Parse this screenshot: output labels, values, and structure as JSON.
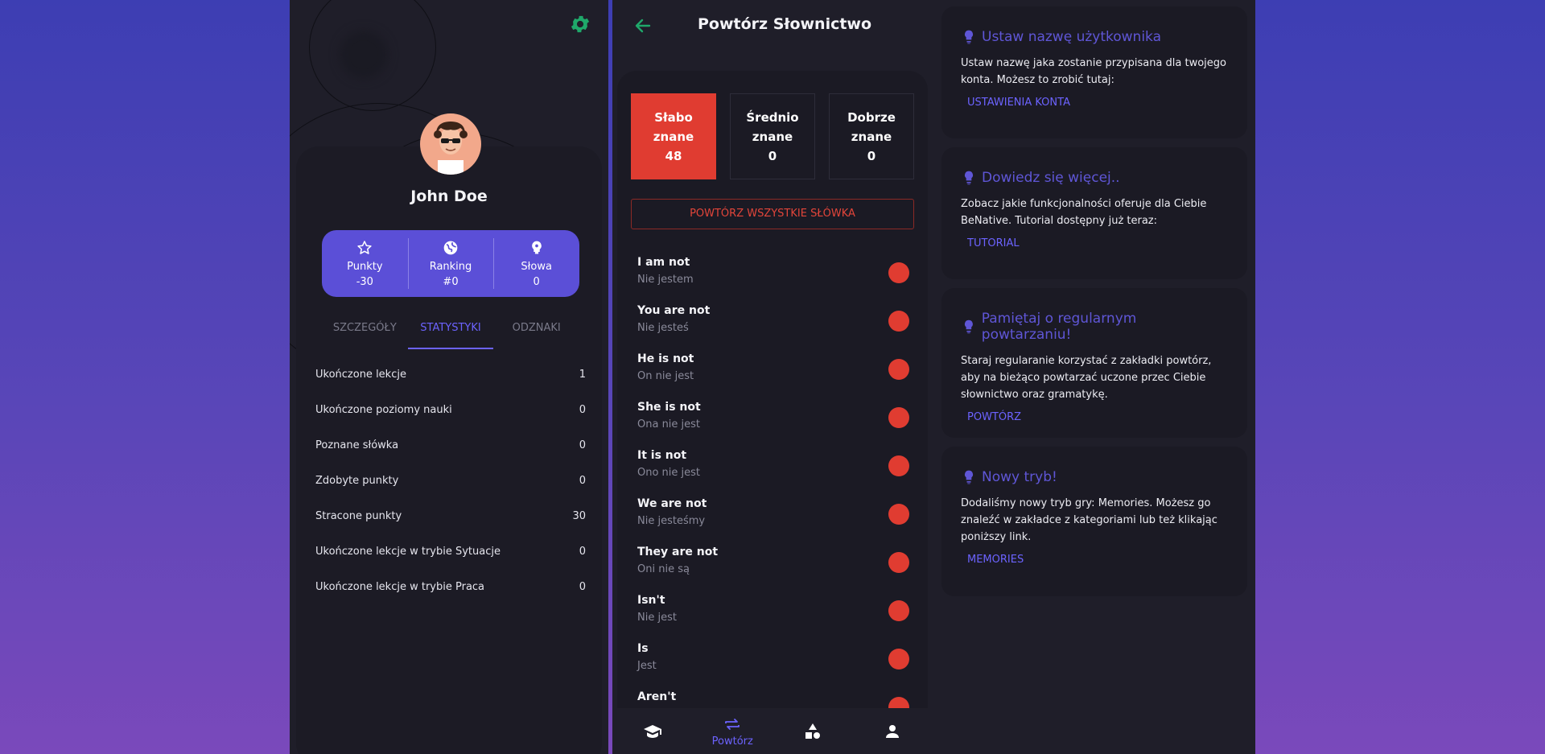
{
  "profile": {
    "name": "John Doe",
    "stats": [
      {
        "label": "Punkty",
        "value": "-30",
        "icon": "star-icon"
      },
      {
        "label": "Ranking",
        "value": "#0",
        "icon": "globe-icon"
      },
      {
        "label": "Słowa",
        "value": "0",
        "icon": "brain-icon"
      }
    ],
    "tabs": [
      "SZCZEGÓŁY",
      "STATYSTYKI",
      "ODZNAKI"
    ],
    "active_tab": "STATYSTYKI",
    "statistics": [
      {
        "label": "Ukończone lekcje",
        "value": "1"
      },
      {
        "label": "Ukończone poziomy nauki",
        "value": "0"
      },
      {
        "label": "Poznane słówka",
        "value": "0"
      },
      {
        "label": "Zdobyte punkty",
        "value": "0"
      },
      {
        "label": "Stracone punkty",
        "value": "30"
      },
      {
        "label": "Ukończone lekcje w trybie Sytuacje",
        "value": "0"
      },
      {
        "label": "Ukończone lekcje w trybie Praca",
        "value": "0"
      }
    ]
  },
  "review": {
    "title": "Powtórz Słownictwo",
    "levels": [
      {
        "line1": "Słabo",
        "line2": "znane",
        "count": "48",
        "active": true
      },
      {
        "line1": "Średnio",
        "line2": "znane",
        "count": "0",
        "active": false
      },
      {
        "line1": "Dobrze",
        "line2": "znane",
        "count": "0",
        "active": false
      }
    ],
    "repeat_all_label": "POWTÓRZ WSZYSTKIE SŁÓWKA",
    "words": [
      {
        "en": "I am not",
        "pl": "Nie jestem"
      },
      {
        "en": "You are not",
        "pl": "Nie jesteś"
      },
      {
        "en": "He is not",
        "pl": "On nie jest"
      },
      {
        "en": "She is not",
        "pl": "Ona nie jest"
      },
      {
        "en": "It is not",
        "pl": "Ono nie jest"
      },
      {
        "en": "We are not",
        "pl": "Nie jesteśmy"
      },
      {
        "en": "They are not",
        "pl": "Oni nie są"
      },
      {
        "en": "Isn't",
        "pl": "Nie jest"
      },
      {
        "en": "Is",
        "pl": "Jest"
      },
      {
        "en": "Aren't",
        "pl": ""
      }
    ],
    "nav": [
      {
        "icon": "graduation-cap-icon",
        "label": ""
      },
      {
        "icon": "repeat-icon",
        "label": "Powtórz"
      },
      {
        "icon": "shapes-icon",
        "label": ""
      },
      {
        "icon": "person-icon",
        "label": ""
      }
    ]
  },
  "tips": [
    {
      "title": "Ustaw nazwę użytkownika",
      "body": "Ustaw nazwę jaka zostanie przypisana dla twojego konta. Możesz to zrobić tutaj:",
      "link": "USTAWIENIA KONTA"
    },
    {
      "title": "Dowiedz się więcej..",
      "body": "Zobacz jakie funkcjonalności oferuje dla Ciebie BeNative. Tutorial dostępny już teraz:",
      "link": "TUTORIAL"
    },
    {
      "title": "Pamiętaj o regularnym powtarzaniu!",
      "body": "Staraj regularanie korzystać z zakładki powtórz, aby na bieżąco powtarzać uczone przec Ciebie słownictwo oraz gramatykę.",
      "link": "POWTÓRZ"
    },
    {
      "title": "Nowy tryb!",
      "body": "Dodaliśmy nowy tryb gry: Memories. Możesz go znaleźć w zakładce z kategoriami lub też klikając poniższy link.",
      "link": "MEMORIES"
    }
  ],
  "colors": {
    "accent": "#5b4fd7",
    "link": "#6c63ff",
    "danger": "#e03c31",
    "gear": "#1fa86a",
    "panel": "#1f1e29"
  }
}
